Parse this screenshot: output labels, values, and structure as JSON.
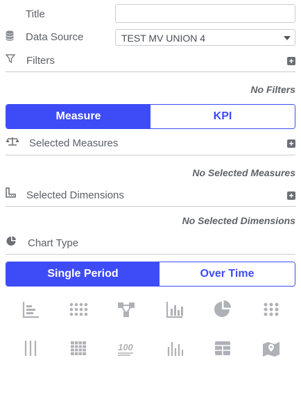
{
  "title": {
    "label": "Title",
    "value": ""
  },
  "data_source": {
    "label": "Data Source",
    "value": "TEST MV UNION 4"
  },
  "filters": {
    "label": "Filters",
    "empty": "No Filters"
  },
  "mode_toggle": {
    "active": "Measure",
    "inactive": "KPI"
  },
  "measures": {
    "label": "Selected Measures",
    "empty": "No Selected Measures"
  },
  "dimensions": {
    "label": "Selected Dimensions",
    "empty": "No Selected Dimensions"
  },
  "chart_type": {
    "label": "Chart Type"
  },
  "period_toggle": {
    "active": "Single Period",
    "inactive": "Over Time"
  },
  "plus_symbol": "+",
  "chart_types_row1": [
    "bar-chart-icon",
    "dot-grid-icon",
    "network-icon",
    "column-chart-icon",
    "pie-chart-icon",
    "dot-matrix-icon"
  ],
  "chart_types_row2": [
    "vertical-lines-icon",
    "grid-icon",
    "hundred-icon",
    "histogram-icon",
    "table-icon",
    "map-icon"
  ],
  "colors": {
    "accent": "#3d4cf6",
    "icon_gray": "#aeb1b6",
    "text": "#5b5f66"
  }
}
